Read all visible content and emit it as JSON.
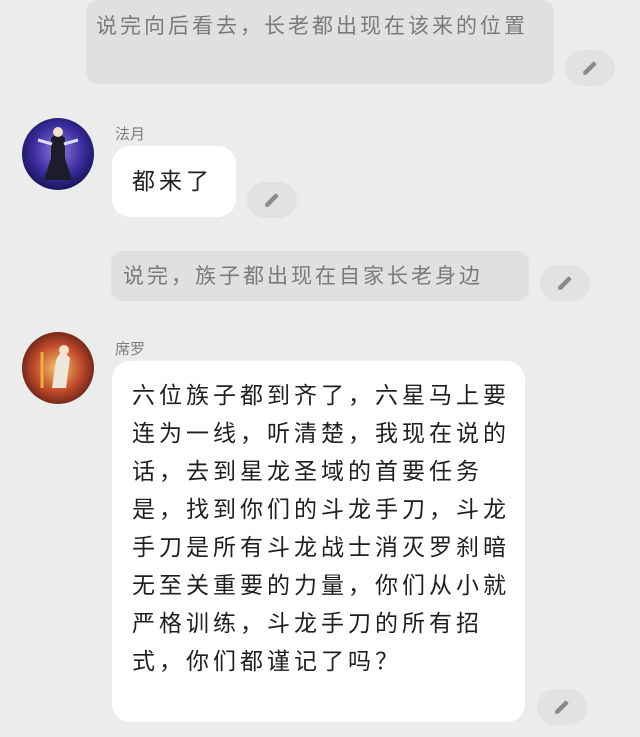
{
  "messages": [
    {
      "type": "narration",
      "text": "说完向后看去，长老都出现在该来的位置"
    },
    {
      "type": "chat",
      "speaker": "法月",
      "text": "都来了"
    },
    {
      "type": "narration",
      "text": "说完，族子都出现在自家长老身边"
    },
    {
      "type": "chat",
      "speaker": "席罗",
      "text": "六位族子都到齐了，六星马上要连为一线，听清楚，我现在说的话，去到星龙圣域的首要任务是，找到你们的斗龙手刀，斗龙手刀是所有斗龙战士消灭罗刹暗无至关重要的力量，你们从小就严格训练，斗龙手刀的所有招式，你们都谨记了吗？"
    }
  ],
  "icons": {
    "edit": "pencil-icon"
  },
  "colors": {
    "background": "#ececec",
    "narration_bg": "#e0e0e0",
    "bubble_bg": "#ffffff",
    "edit_button_bg": "#e2e2e2"
  }
}
